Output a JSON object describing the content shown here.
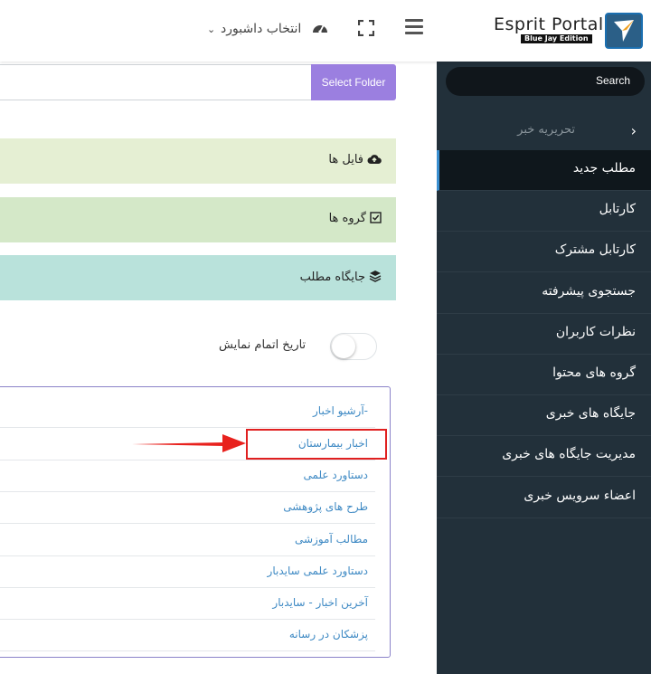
{
  "header": {
    "logo_title": "Esprit Portal",
    "logo_subtitle": "Blue Jay Edition",
    "dashboard_select": "انتخاب داشبورد",
    "icons": [
      "hamburger-icon",
      "fullscreen-icon",
      "dashboard-gauge-icon",
      "chevron-down-icon"
    ]
  },
  "sidebar": {
    "search_label": "Search",
    "group_label": "تحریریه خبر",
    "items": [
      {
        "label": "مطلب جدید",
        "active": true
      },
      {
        "label": "کارتابل",
        "active": false
      },
      {
        "label": "کارتابل مشترک",
        "active": false
      },
      {
        "label": "جستجوی پیشرفته",
        "active": false
      },
      {
        "label": "نظرات کاربران",
        "active": false
      },
      {
        "label": "گروه های محتوا",
        "active": false
      },
      {
        "label": "جایگاه های خبری",
        "active": false
      },
      {
        "label": "مدیریت جایگاه های خبری",
        "active": false
      },
      {
        "label": "اعضاء سرویس خبری",
        "active": false
      }
    ]
  },
  "main": {
    "folder_button": "Select Folder",
    "panels": [
      {
        "label": "فایل ها",
        "icon": "cloud-upload-icon",
        "color": "#e5efd3"
      },
      {
        "label": "گروه ها",
        "icon": "checkbox-icon",
        "color": "#d4e8c8"
      },
      {
        "label": "جایگاه مطلب",
        "icon": "layers-icon",
        "color": "#b9e2db"
      }
    ],
    "toggle_label": "تاریخ اتمام نمایش",
    "toggle_on": false,
    "list_items": [
      "-آرشیو اخبار",
      "اخبار بیمارستان",
      "دستاورد علمی",
      "طرح های پژوهشی",
      "مطالب آموزشی",
      "دستاورد علمی سایدبار",
      "آخرین اخبار - سایدبار",
      "پزشکان در رسانه"
    ]
  },
  "colors": {
    "sidebar_bg": "#22303a",
    "sidebar_active_bg": "#0f171c",
    "accent_blue": "#3a8fd0",
    "folder_button": "#9b7fe0",
    "list_link": "#3f8ac4",
    "highlight_red": "#e02020"
  }
}
